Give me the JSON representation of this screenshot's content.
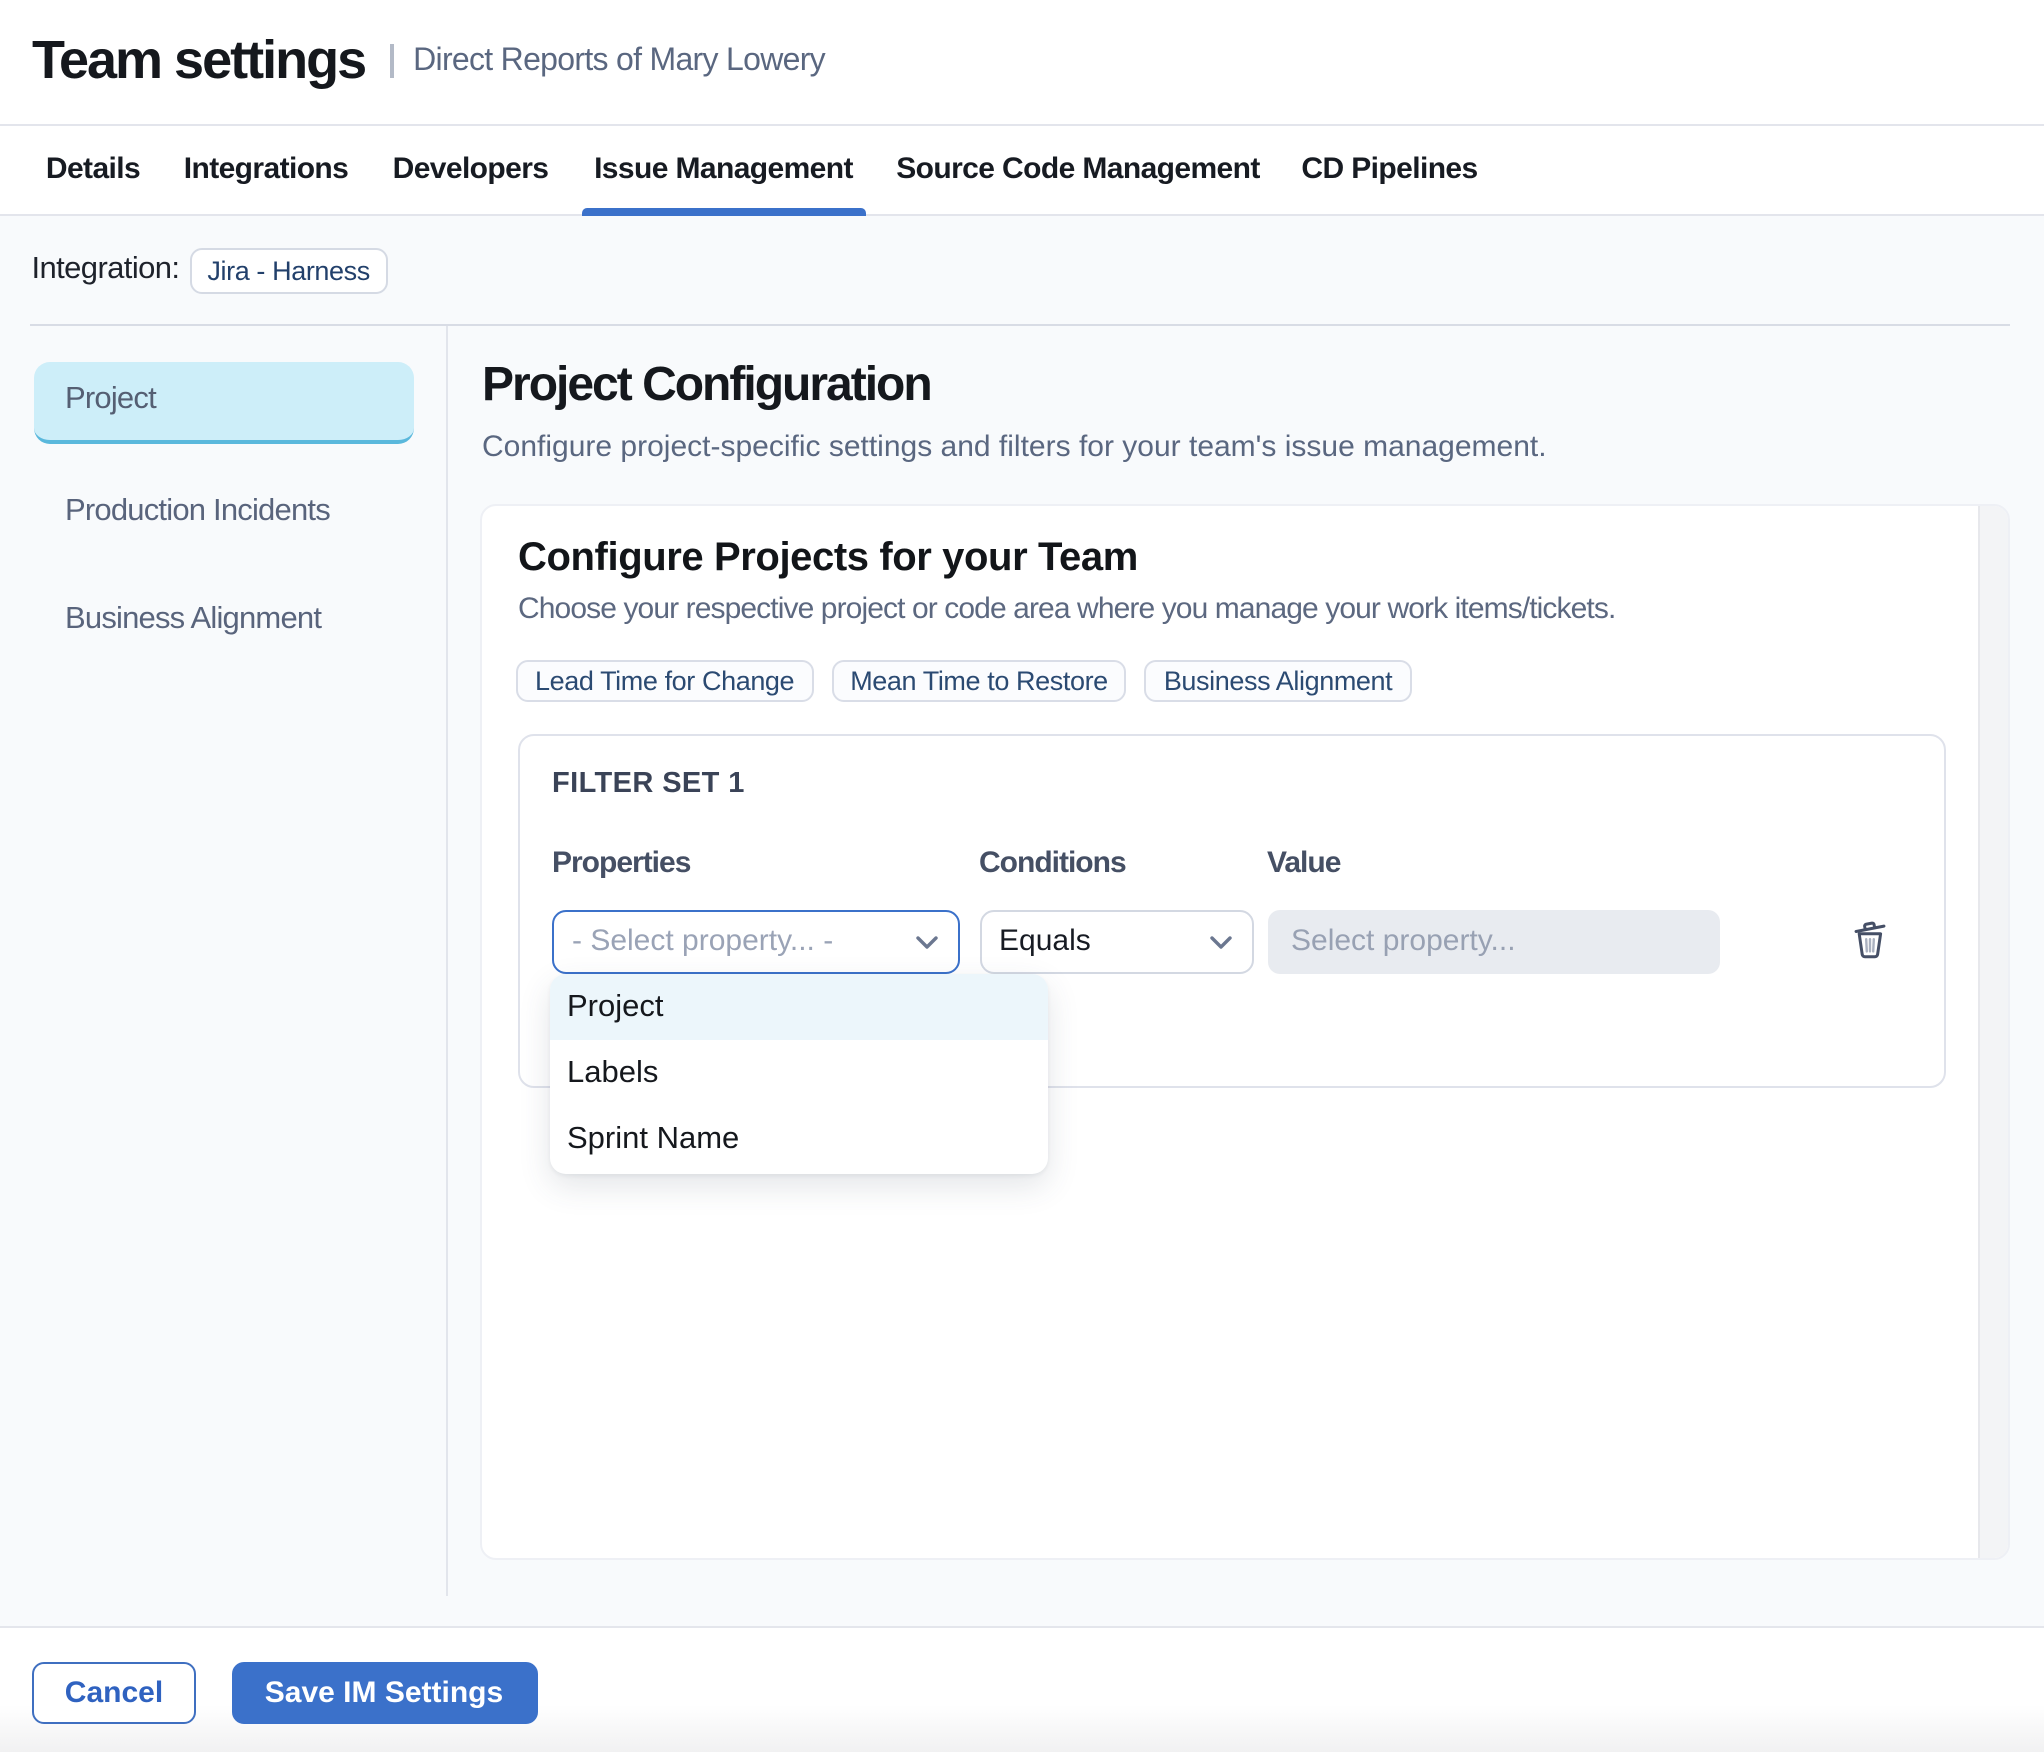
{
  "header": {
    "title": "Team settings",
    "subtitle": "Direct Reports of Mary Lowery"
  },
  "tabs": {
    "items": [
      {
        "label": "Details",
        "active": false
      },
      {
        "label": "Integrations",
        "active": false
      },
      {
        "label": "Developers",
        "active": false
      },
      {
        "label": "Issue Management",
        "active": true
      },
      {
        "label": "Source Code Management",
        "active": false
      },
      {
        "label": "CD Pipelines",
        "active": false
      }
    ]
  },
  "integration": {
    "label": "Integration:",
    "value": "Jira - Harness"
  },
  "sidebar": {
    "items": [
      {
        "label": "Project",
        "active": true
      },
      {
        "label": "Production Incidents",
        "active": false
      },
      {
        "label": "Business Alignment",
        "active": false
      }
    ]
  },
  "main": {
    "title": "Project Configuration",
    "description": "Configure project-specific settings and filters for your team's issue management."
  },
  "card": {
    "title": "Configure Projects for your Team",
    "description": "Choose your respective project or code area where you manage your work items/tickets.",
    "chips": [
      {
        "label": "Lead Time for Change"
      },
      {
        "label": "Mean Time to Restore"
      },
      {
        "label": "Business Alignment"
      }
    ]
  },
  "filter_set": {
    "title": "FILTER SET 1",
    "columns": {
      "properties": "Properties",
      "conditions": "Conditions",
      "value": "Value"
    },
    "properties_placeholder": "- Select property... -",
    "conditions_value": "Equals",
    "value_placeholder": "Select property...",
    "icons": {
      "delete": "trash-icon",
      "expand": "chevron-down-icon"
    }
  },
  "dropdown": {
    "options": [
      {
        "label": "Project",
        "highlighted": true
      },
      {
        "label": "Labels",
        "highlighted": false
      },
      {
        "label": "Sprint Name",
        "highlighted": false
      }
    ]
  },
  "footer": {
    "cancel_label": "Cancel",
    "save_label": "Save IM Settings"
  },
  "colors": {
    "accent_blue": "#3b71ca",
    "selected_nav_bg": "#cdeef9",
    "selected_nav_border": "#5ab8dc",
    "page_background": "#f8fafc",
    "highlight_option_bg": "#ecf6fb",
    "chip_text": "#2b4a72",
    "muted_text": "#5a6780"
  }
}
